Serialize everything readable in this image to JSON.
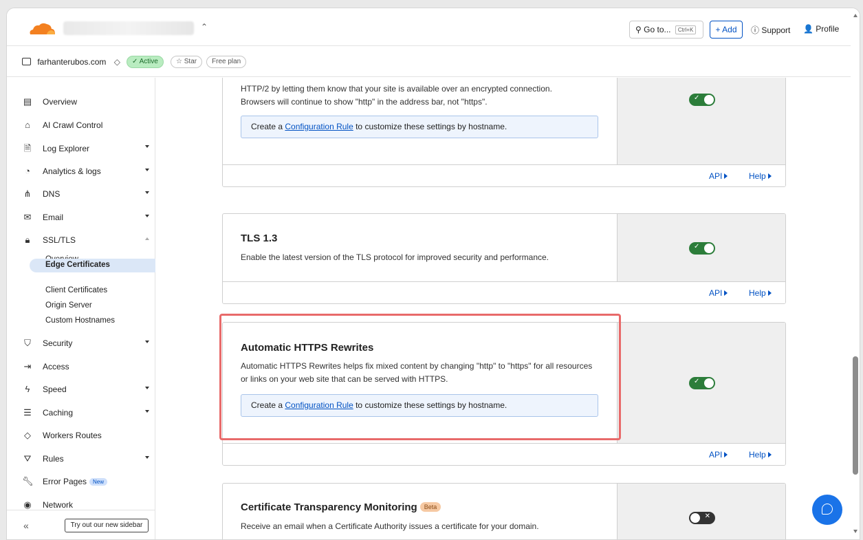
{
  "topbar": {
    "goto_label": "Go to...",
    "goto_shortcut": "Ctrl+K",
    "add_label": "+ Add",
    "support_label": "Support",
    "profile_label": "Profile"
  },
  "zone": {
    "domain": "farhanterubos.com",
    "status": "✓ Active",
    "star": "☆ Star",
    "plan": "Free plan"
  },
  "sidebar": {
    "items": [
      {
        "label": "Overview",
        "icon": "document-icon"
      },
      {
        "label": "AI Crawl Control",
        "icon": "robot-icon"
      },
      {
        "label": "Log Explorer",
        "icon": "file-search-icon"
      },
      {
        "label": "Analytics & logs",
        "icon": "pie-chart-icon"
      },
      {
        "label": "DNS",
        "icon": "network-tree-icon"
      },
      {
        "label": "Email",
        "icon": "email-icon"
      },
      {
        "label": "SSL/TLS",
        "icon": "lock-icon"
      },
      {
        "label": "Security",
        "icon": "shield-icon"
      },
      {
        "label": "Access",
        "icon": "sign-in-icon"
      },
      {
        "label": "Speed",
        "icon": "lightning-icon"
      },
      {
        "label": "Caching",
        "icon": "server-icon"
      },
      {
        "label": "Workers Routes",
        "icon": "workers-icon"
      },
      {
        "label": "Rules",
        "icon": "rules-icon"
      },
      {
        "label": "Error Pages",
        "icon": "wrench-icon",
        "badge": "New"
      },
      {
        "label": "Network",
        "icon": "location-pin-icon"
      }
    ],
    "ssl_sub": [
      "Overview",
      "Edge Certificates",
      "Client Certificates",
      "Origin Server",
      "Custom Hostnames"
    ],
    "try_label": "Try out our new sidebar",
    "collapse_glyph": "«"
  },
  "cards": {
    "https": {
      "desc_line1": "HTTP/2 by letting them know that your site is available over an encrypted connection.",
      "desc_line2": "Browsers will continue to show \"http\" in the address bar, not \"https\"."
    },
    "tls13": {
      "title": "TLS 1.3",
      "desc": "Enable the latest version of the TLS protocol for improved security and performance."
    },
    "rewrites": {
      "title": "Automatic HTTPS Rewrites",
      "desc": "Automatic HTTPS Rewrites helps fix mixed content by changing \"http\" to \"https\" for all resources or links on your web site that can be served with HTTPS."
    },
    "ctm": {
      "title": "Certificate Transparency Monitoring",
      "badge": "Beta",
      "desc": "Receive an email when a Certificate Authority issues a certificate for your domain."
    },
    "cfg_prefix": "Create a ",
    "cfg_link": "Configuration Rule",
    "cfg_suffix": " to customize these settings by hostname.",
    "api_label": "API",
    "help_label": "Help"
  },
  "colors": {
    "accent": "#0051c3",
    "toggle_on": "#2c7d3a",
    "highlight": "#e86a6a"
  }
}
